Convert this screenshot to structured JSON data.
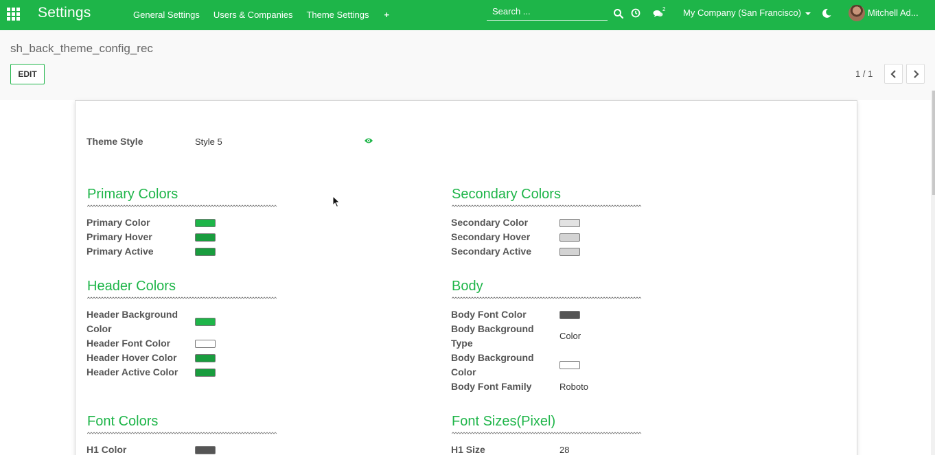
{
  "navbar": {
    "brand": "Settings",
    "menu": [
      "General Settings",
      "Users & Companies",
      "Theme Settings"
    ],
    "search_placeholder": "Search ...",
    "messages_badge": "2",
    "company": "My Company (San Francisco)",
    "user": "Mitchell Ad..."
  },
  "control": {
    "breadcrumb": "sh_back_theme_config_rec",
    "edit_label": "EDIT",
    "pager": "1 / 1"
  },
  "theme_style": {
    "label": "Theme Style",
    "value": "Style 5"
  },
  "sections": {
    "primary": {
      "title": "Primary Colors",
      "rows": [
        {
          "label": "Primary Color",
          "color": "#1eb549"
        },
        {
          "label": "Primary Hover",
          "color": "#199c3e"
        },
        {
          "label": "Primary Active",
          "color": "#199c3e"
        }
      ]
    },
    "secondary": {
      "title": "Secondary Colors",
      "rows": [
        {
          "label": "Secondary Color",
          "color": "#e2e2e2"
        },
        {
          "label": "Secondary Hover",
          "color": "#d3d3d3"
        },
        {
          "label": "Secondary Active",
          "color": "#d3d3d3"
        }
      ]
    },
    "header": {
      "title": "Header Colors",
      "rows": [
        {
          "label_line1": "Header Background",
          "label_line2": "Color",
          "color": "#1eb549"
        },
        {
          "label": "Header Font Color",
          "color": "#ffffff"
        },
        {
          "label": "Header Hover Color",
          "color": "#199c3e"
        },
        {
          "label": "Header Active Color",
          "color": "#199c3e"
        }
      ]
    },
    "body": {
      "title": "Body",
      "font_color_label": "Body Font Color",
      "font_color": "#555555",
      "bg_type_line1": "Body Background",
      "bg_type_line2": "Type",
      "bg_type_value": "Color",
      "bg_color_line1": "Body Background",
      "bg_color_line2": "Color",
      "bg_color": "#ffffff",
      "font_family_label": "Body Font Family",
      "font_family_value": "Roboto"
    },
    "font_colors": {
      "title": "Font Colors",
      "rows": [
        {
          "label": "H1 Color",
          "color": "#555555"
        }
      ]
    },
    "font_sizes": {
      "title": "Font Sizes(Pixel)",
      "rows": [
        {
          "label": "H1 Size",
          "value": "28"
        }
      ]
    }
  },
  "colors": {
    "brand_green": "#1eb549"
  }
}
